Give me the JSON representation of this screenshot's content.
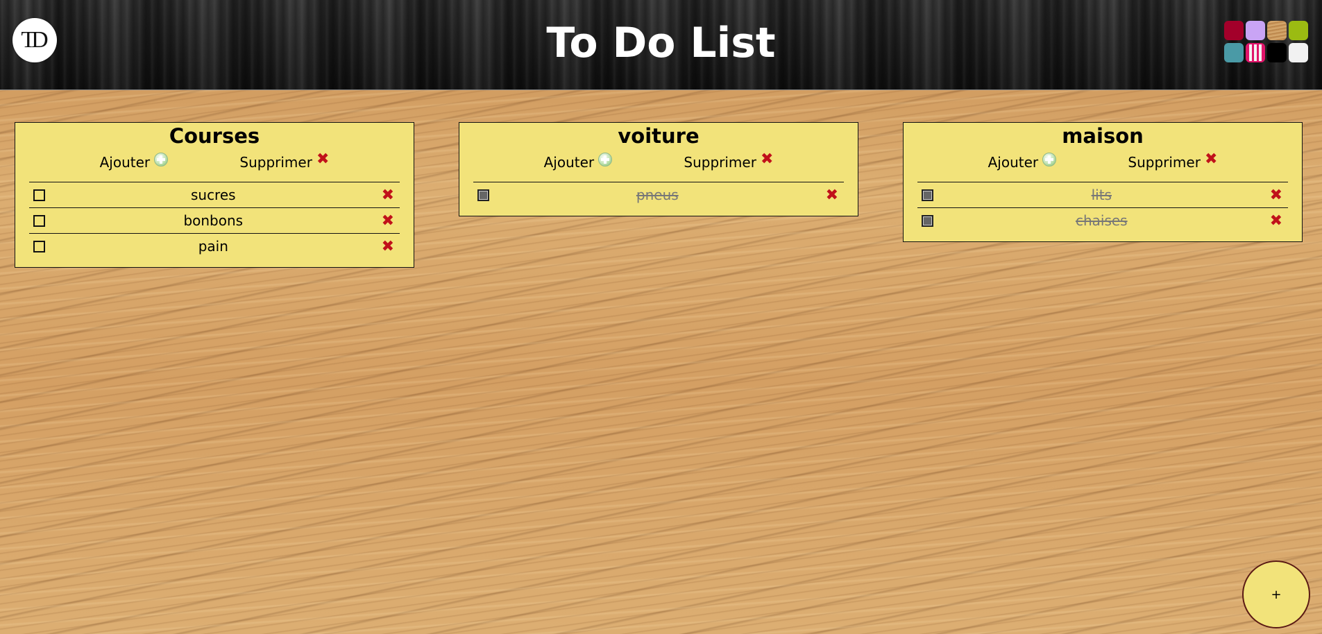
{
  "header": {
    "logo_text": "TD",
    "title": "To Do List",
    "swatches": [
      {
        "color": "#a3002a",
        "kind": "solid"
      },
      {
        "color": "#c9a4f5",
        "kind": "solid"
      },
      {
        "color": "#c9955a",
        "kind": "wood"
      },
      {
        "color": "#9bbb12",
        "kind": "solid"
      },
      {
        "color": "#4a9aa6",
        "kind": "solid"
      },
      {
        "color": "#e0156a",
        "kind": "pattern"
      },
      {
        "color": "#000000",
        "kind": "solid"
      },
      {
        "color": "#f1f1f1",
        "kind": "solid"
      }
    ]
  },
  "boards": [
    {
      "title": "Courses",
      "add_label": "Ajouter",
      "delete_label": "Supprimer",
      "items": [
        {
          "text": "sucres",
          "done": false
        },
        {
          "text": "bonbons",
          "done": false
        },
        {
          "text": "pain",
          "done": false
        }
      ]
    },
    {
      "title": "voiture",
      "add_label": "Ajouter",
      "delete_label": "Supprimer",
      "items": [
        {
          "text": "pneus",
          "done": true
        }
      ]
    },
    {
      "title": "maison",
      "add_label": "Ajouter",
      "delete_label": "Supprimer",
      "items": [
        {
          "text": "lits",
          "done": true
        },
        {
          "text": "chaises",
          "done": true
        }
      ]
    }
  ],
  "icons": {
    "delete_glyph": "✖",
    "add_board_glyph": "+"
  },
  "fab": {
    "label": "+"
  }
}
